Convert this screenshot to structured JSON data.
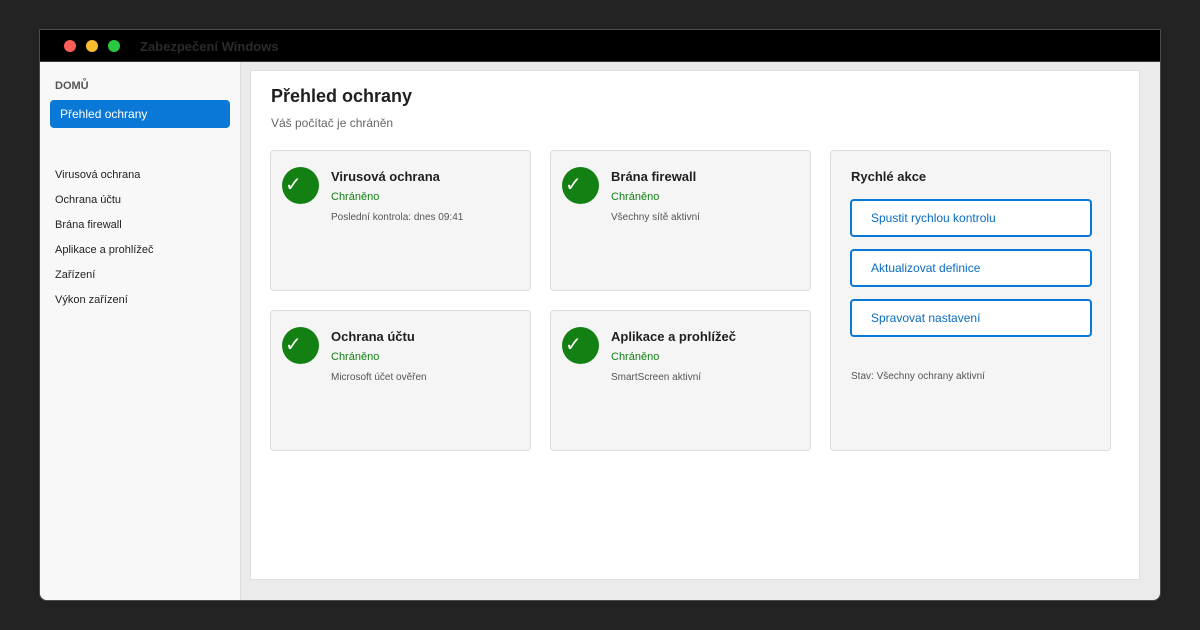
{
  "window": {
    "title": "Zabezpečení Windows"
  },
  "sidebar": {
    "section_label": "DOMŮ",
    "active_item": "Přehled ochrany",
    "items": [
      "Virusová ochrana",
      "Ochrana účtu",
      "Brána firewall",
      "Aplikace a prohlížeč",
      "Zařízení",
      "Výkon zařízení"
    ]
  },
  "main": {
    "title": "Přehled ochrany",
    "subtitle": "Váš počítač je chráněn",
    "cards": [
      {
        "title": "Virusová ochrana",
        "status": "Chráněno",
        "detail": "Poslední kontrola: dnes 09:41",
        "icon": "check-icon"
      },
      {
        "title": "Brána firewall",
        "status": "Chráněno",
        "detail": "Všechny sítě aktivní",
        "icon": "check-icon"
      },
      {
        "title": "Ochrana účtu",
        "status": "Chráněno",
        "detail": "Microsoft účet ověřen",
        "icon": "check-icon"
      },
      {
        "title": "Aplikace a prohlížeč",
        "status": "Chráněno",
        "detail": "SmartScreen aktivní",
        "icon": "check-icon"
      }
    ],
    "quick_actions": {
      "title": "Rychlé akce",
      "buttons": [
        "Spustit rychlou kontrolu",
        "Aktualizovat definice",
        "Spravovat nastavení"
      ],
      "footer": "Stav: Všechny ochrany aktivní"
    }
  },
  "colors": {
    "accent": "#0a78d7",
    "protected": "#138013",
    "titlebar": "#000000"
  },
  "icons": {
    "check": "✓"
  }
}
